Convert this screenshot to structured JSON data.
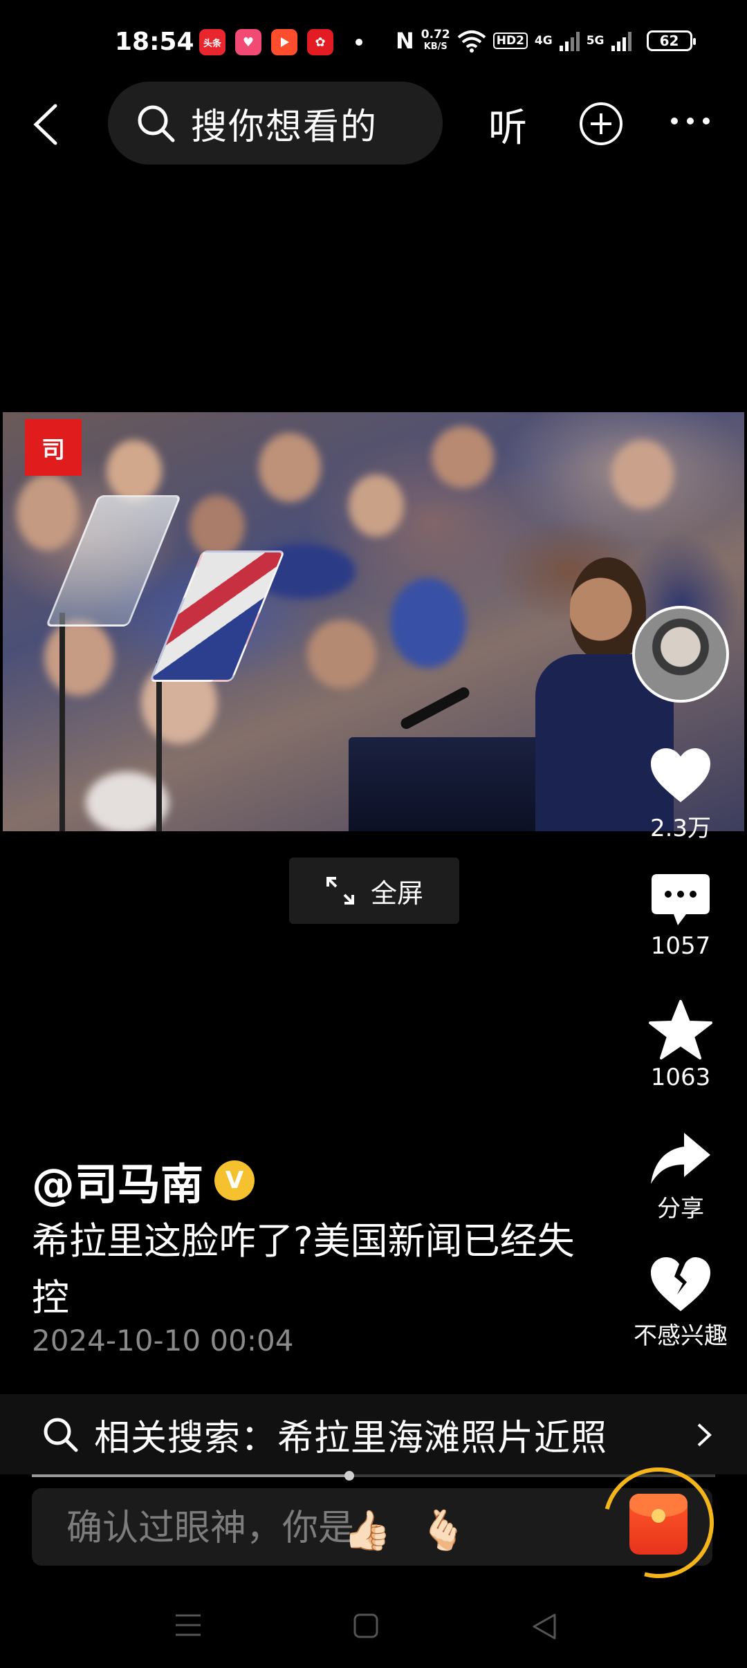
{
  "status_bar": {
    "time": "18:54",
    "app_icons": [
      "头条",
      "抖音极速",
      "视频",
      "快手"
    ],
    "net_speed_value": "0.72",
    "net_speed_unit": "KB/S",
    "hd_label": "HD2",
    "sig1_label": "4G",
    "sig2_label": "5G",
    "battery": "62"
  },
  "top_nav": {
    "search_placeholder": "搜你想看的",
    "listen_label": "听"
  },
  "video": {
    "logo_char": "司",
    "fullscreen_label": "全屏"
  },
  "right_rail": {
    "like_count": "2.3万",
    "comment_count": "1057",
    "favorite_count": "1063",
    "share_label": "分享",
    "dislike_label": "不感兴趣"
  },
  "post": {
    "author": "@司马南",
    "verified_mark": "V",
    "caption": "希拉里这脸咋了?美国新闻已经失控",
    "timestamp": "2024-10-10 00:04"
  },
  "related_search": {
    "text": "相关搜索：希拉里海滩照片近照"
  },
  "progress": {
    "fraction": 0.465
  },
  "comment_bar": {
    "placeholder": "确认过眼神，你是...",
    "emoji_1": "👍🏻",
    "emoji_2": "🫰🏻"
  },
  "colors": {
    "background": "#000000",
    "accent_gold": "#f3b51a",
    "verified": "#f5c12e",
    "logo_red": "#e01c1c"
  },
  "icons": [
    "back-icon",
    "search-icon",
    "plus-circle-icon",
    "more-icon",
    "expand-icon",
    "heart-icon",
    "comment-icon",
    "star-icon",
    "share-icon",
    "broken-heart-icon",
    "chevron-right-icon",
    "red-packet-icon",
    "menu-icon",
    "home-icon",
    "back-triangle-icon"
  ]
}
